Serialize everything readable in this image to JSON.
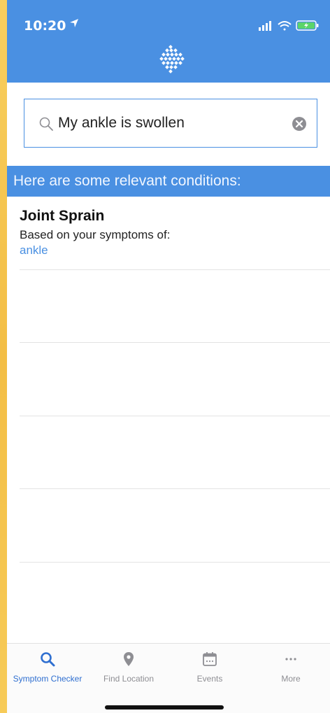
{
  "status_bar": {
    "time": "10:20"
  },
  "search": {
    "value": "My ankle is swollen",
    "placeholder": ""
  },
  "section": {
    "header": "Here are some relevant conditions:"
  },
  "results": [
    {
      "title": "Joint Sprain",
      "subtitle": "Based on your symptoms of:",
      "symptom": "ankle"
    }
  ],
  "tabbar": {
    "tabs": [
      {
        "label": "Symptom Checker",
        "icon": "search-icon",
        "active": true
      },
      {
        "label": "Find Location",
        "icon": "map-pin-icon",
        "active": false
      },
      {
        "label": "Events",
        "icon": "calendar-icon",
        "active": false
      },
      {
        "label": "More",
        "icon": "more-dots-icon",
        "active": false
      }
    ]
  },
  "colors": {
    "primary": "#4a90e2",
    "active_tab": "#2f6fd0",
    "inactive_tab": "#8e8e93",
    "device_frame": "#f6c451"
  }
}
